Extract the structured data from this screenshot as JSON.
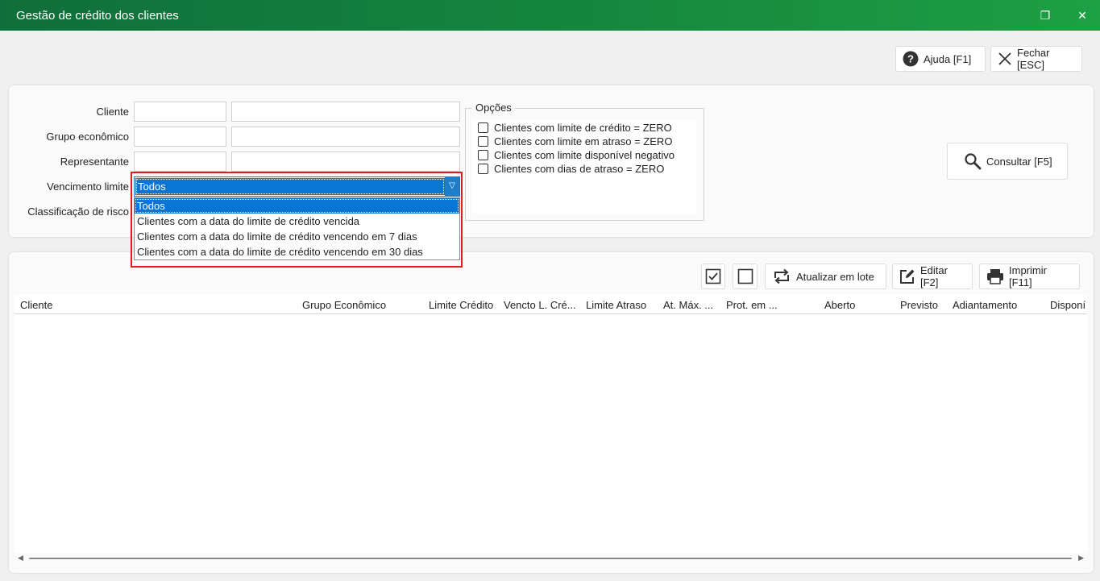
{
  "window": {
    "title": "Gestão de crédito dos clientes",
    "restore_glyph": "❐",
    "close_glyph": "✕"
  },
  "toolbar": {
    "help_label": "Ajuda [F1]",
    "close_label": "Fechar [ESC]"
  },
  "filters": {
    "cliente_label": "Cliente",
    "grupo_label": "Grupo econômico",
    "representante_label": "Representante",
    "vencimento_label": "Vencimento limite",
    "classificacao_label": "Classificação de risco",
    "vencimento_selected": "Todos",
    "vencimento_options": [
      "Todos",
      "Clientes com a data do limite de crédito vencida",
      "Clientes com a data do limite de crédito vencendo em 7 dias",
      "Clientes com a data do limite de crédito vencendo em 30 dias"
    ]
  },
  "options": {
    "legend": "Opções",
    "items": [
      {
        "label": "Clientes com limite de crédito = ZERO",
        "checked": false
      },
      {
        "label": "Clientes com limite em atraso = ZERO",
        "checked": false
      },
      {
        "label": "Clientes com limite disponível negativo",
        "checked": false
      },
      {
        "label": "Clientes com dias de atraso = ZERO",
        "checked": false
      }
    ]
  },
  "consultar_label": "Consultar [F5]",
  "grid_toolbar": {
    "batch_label": "Atualizar em lote",
    "edit_label": "Editar [F2]",
    "print_label": "Imprimir [F11]"
  },
  "grid": {
    "columns": [
      "Cliente",
      "Grupo Econômico",
      "Limite Crédito",
      "Vencto L. Cré...",
      "Limite Atraso",
      "At. Máx. ...",
      "Prot. em ...",
      "Aberto",
      "Previsto",
      "Adiantamento",
      "Disponí"
    ]
  },
  "colors": {
    "titlebar": "#16873f",
    "selection": "#0a75d3",
    "highlight_box": "#e01b24"
  },
  "icons": [
    "help-icon",
    "close-icon",
    "search-icon",
    "check-all-icon",
    "uncheck-all-icon",
    "refresh-icon",
    "edit-icon",
    "print-icon"
  ]
}
